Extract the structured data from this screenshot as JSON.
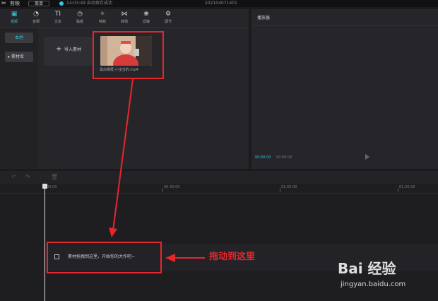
{
  "titlebar": {
    "app_name": "剪映",
    "menu_label": "菜单",
    "save_status": "14:03:49 自动保存成功",
    "project_name": "202104071401"
  },
  "toolbar": {
    "items": [
      {
        "label": "视频",
        "icon": "media-icon"
      },
      {
        "label": "音频",
        "icon": "audio-icon"
      },
      {
        "label": "文本",
        "icon": "text-icon"
      },
      {
        "label": "贴纸",
        "icon": "sticker-icon"
      },
      {
        "label": "特效",
        "icon": "effects-icon"
      },
      {
        "label": "转场",
        "icon": "transition-icon"
      },
      {
        "label": "滤镜",
        "icon": "filter-icon"
      },
      {
        "label": "调节",
        "icon": "adjust-icon"
      }
    ]
  },
  "sidebar": {
    "items": [
      {
        "label": "本地"
      },
      {
        "label": "▸ 素材库"
      }
    ]
  },
  "media": {
    "import_label": "导入素材",
    "clip_filename": "黑白相框-小宝宝的.mp4"
  },
  "player": {
    "title": "播放器",
    "current_time": "00:00:00",
    "total_time": "00:00:00"
  },
  "timeline": {
    "ticks": [
      "00:00",
      "00:30:00",
      "01:00:00",
      "01:30:00"
    ],
    "drop_hint": "素材拖拽到这里，开始你的大作吧~"
  },
  "annotation": {
    "text": "拖动到这里",
    "color": "#e8262a"
  },
  "watermark": {
    "main": "Bai 经验",
    "url": "jingyan.baidu.com"
  },
  "colors": {
    "accent": "#2fc3d6",
    "highlight": "#e8262a"
  }
}
